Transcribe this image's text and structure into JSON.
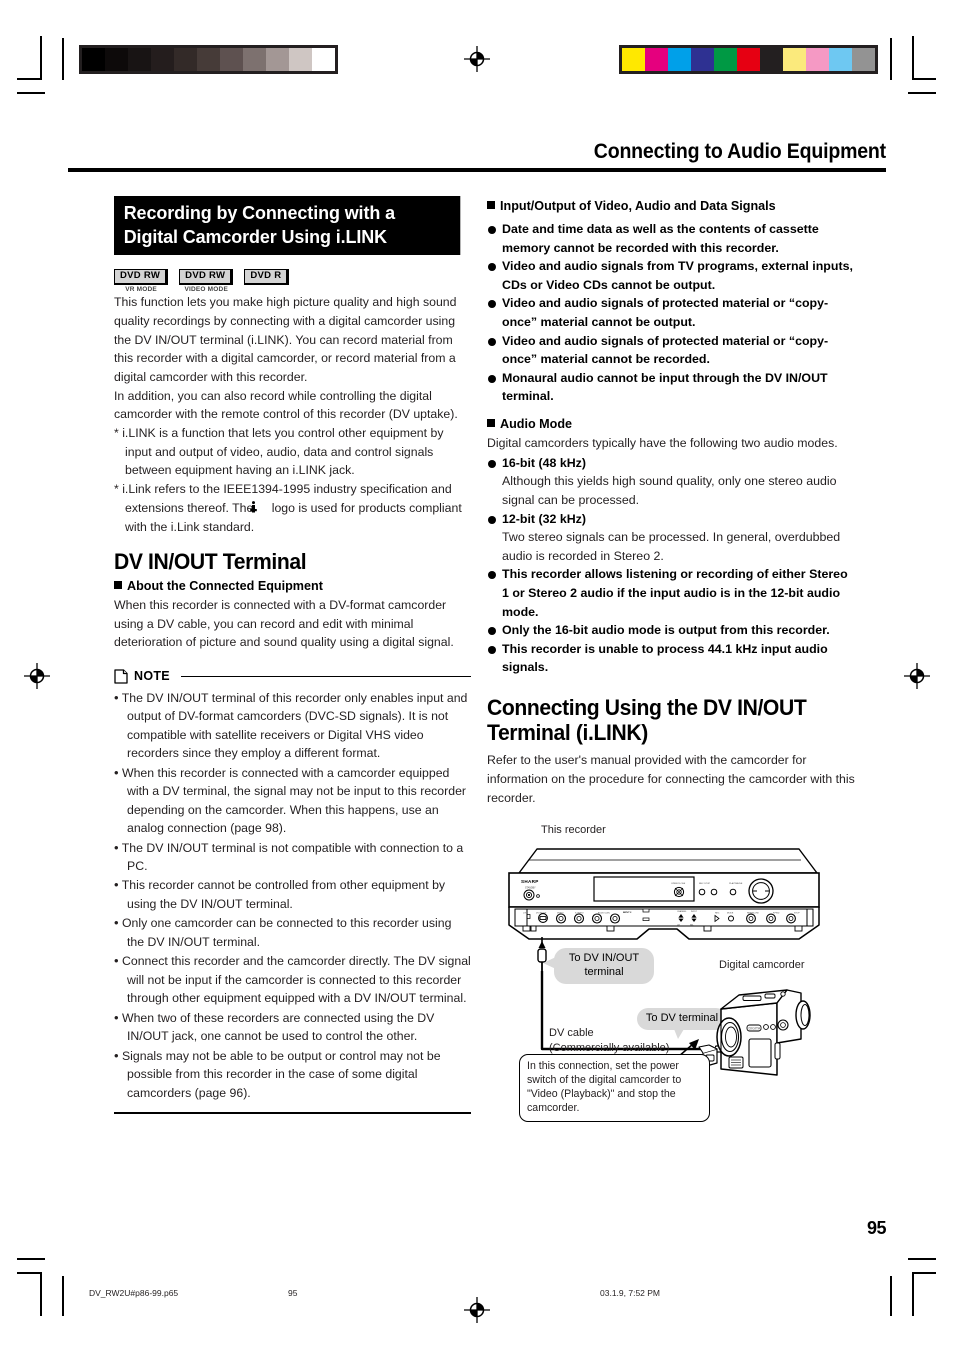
{
  "header": {
    "title": "Connecting to Audio Equipment"
  },
  "left": {
    "section_title": "Recording by Connecting with a Digital Camcorder Using i.LINK",
    "badges": [
      {
        "top": "DVD RW",
        "sub": "VR MODE"
      },
      {
        "top": "DVD RW",
        "sub": "VIDEO MODE"
      },
      {
        "top": "DVD R",
        "sub": ""
      }
    ],
    "intro_p1": "This function lets you make high picture quality and high sound quality recordings by connecting with a digital camcorder using the DV IN/OUT terminal (i.LINK). You can record material from this recorder with a digital camcorder, or record material from a digital camcorder with this recorder.",
    "intro_p2": "In addition, you can also record while controlling the digital camcorder with the remote control of this recorder (DV uptake).",
    "footnotes": [
      "* i.LINK is a function that lets you control other equipment by input and output of video, audio, data and control signals between equipment having an i.LINK jack.",
      "* i.Link refers to the IEEE1394-1995 industry specification and extensions thereof. The",
      "logo is used for products compliant with the i.Link standard."
    ],
    "dv_heading": "DV IN/OUT Terminal",
    "about_heading": "About the Connected Equipment",
    "about_body": "When this recorder is connected with a DV-format camcorder using a DV cable, you can record and edit with minimal deterioration of picture and sound quality using a digital signal.",
    "note_label": "NOTE",
    "note_items": [
      "The DV IN/OUT terminal of this recorder only enables input and output of DV-format camcorders (DVC-SD signals). It is not compatible with satellite receivers or Digital VHS video recorders since they employ a different format.",
      "When this recorder is connected with a camcorder equipped with a DV terminal, the signal may not be input to this recorder depending on the camcorder. When this happens, use an analog connection (page 98).",
      "The DV IN/OUT terminal is not compatible with connection to a PC.",
      "This recorder cannot be controlled from other equipment by using the DV IN/OUT terminal.",
      "Only one camcorder can be connected to this recorder using the DV IN/OUT terminal.",
      "Connect this recorder and the camcorder directly. The DV signal will not be input if the camcorder is connected to this recorder through other equipment equipped with a DV IN/OUT terminal.",
      "When two of these recorders are connected using the DV IN/OUT jack, one cannot be used to control the other.",
      "Signals may not be able to be output or control may not be possible from this recorder in the case of some digital camcorders (page 96)."
    ]
  },
  "right": {
    "io_heading": "Input/Output of Video, Audio and Data Signals",
    "io_items": [
      "Date and time data as well as the contents of cassette memory cannot be recorded with this recorder.",
      "Video and audio signals from TV programs, external inputs, CDs or Video CDs cannot be output.",
      "Video and audio signals of protected material or “copy-once” material cannot be output.",
      "Video and audio signals of protected material or “copy-once” material cannot be recorded.",
      "Monaural audio cannot be input through the DV IN/OUT terminal."
    ],
    "audio_heading": "Audio Mode",
    "audio_intro": "Digital camcorders typically have the following two audio modes.",
    "audio_items": [
      {
        "bold": "16-bit (48 kHz)",
        "normal": "Although this yields high sound quality, only one stereo audio signal can be processed."
      },
      {
        "bold": "12-bit (32 kHz)",
        "normal": "Two stereo signals can be processed. In general, overdubbed audio is recorded in Stereo 2."
      },
      {
        "bold": "This recorder allows listening or recording of either Stereo 1 or Stereo 2 audio if the input audio is in the 12-bit audio mode.",
        "normal": ""
      },
      {
        "bold": "Only the 16-bit audio mode is output from this recorder.",
        "normal": ""
      },
      {
        "bold": "This recorder is unable to process 44.1 kHz input audio signals.",
        "normal": ""
      }
    ],
    "connect_heading": "Connecting Using the DV IN/OUT Terminal (i.LINK)",
    "connect_body": "Refer to the user's manual provided with the camcorder for information on the procedure for connecting the camcorder with this recorder.",
    "diagram": {
      "label_recorder": "This recorder",
      "label_camcorder": "Digital camcorder",
      "callout_dv_inout": "To DV IN/OUT\nterminal",
      "callout_dv_terminal": "To DV terminal",
      "label_cable": "DV cable\n(Commercially available)",
      "note_box": "In this connection, set the power switch of the digital camcorder to \"Video (Playback)\" and stop the camcorder.",
      "brand": "SHARP"
    }
  },
  "page_number": "95",
  "footer": {
    "filename": "DV_RW2U#p86-99.p65",
    "page": "95",
    "timestamp": "03.1.9, 7:52 PM"
  },
  "colorbars": {
    "gray_ramp": [
      "#000000",
      "#0d0a0a",
      "#181414",
      "#241d1d",
      "#332a28",
      "#463b38",
      "#5e5150",
      "#7d716f",
      "#a39795",
      "#cfc6c3",
      "#ffffff"
    ],
    "color_ramp": [
      "#ffe800",
      "#e5007e",
      "#00a0e9",
      "#2e3192",
      "#009944",
      "#e60012",
      "#231f20",
      "#fbea7c",
      "#f599c4",
      "#6ec8f2",
      "#939393"
    ]
  }
}
